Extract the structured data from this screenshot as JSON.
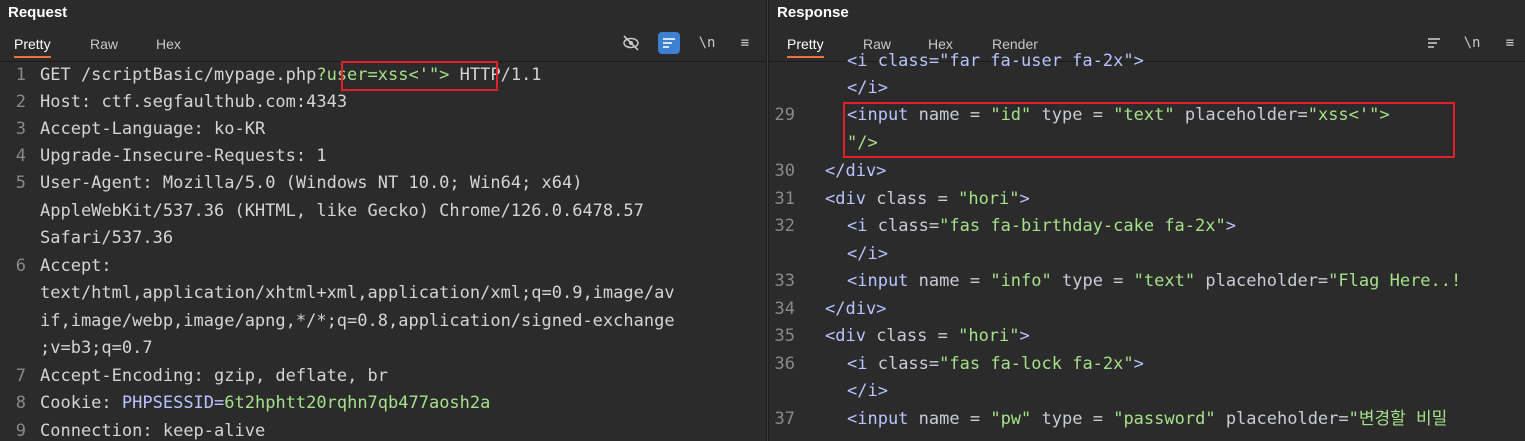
{
  "request": {
    "title": "Request",
    "tabs": [
      "Pretty",
      "Raw",
      "Hex"
    ],
    "active_tab": "Pretty",
    "tools": {
      "wrap_label": "\\n",
      "menu_label": "≡"
    },
    "lines": [
      {
        "num": "1",
        "method": "GET /scriptBasic/mypage.php",
        "query_key": "?user=",
        "query_val": "xss<'\">",
        "tail": " HTTP/1.1"
      },
      {
        "num": "2",
        "name": "Host",
        "value": "ctf.segfaulthub.com:4343"
      },
      {
        "num": "3",
        "name": "Accept-Language",
        "value": "ko-KR"
      },
      {
        "num": "4",
        "name": "Upgrade-Insecure-Requests",
        "value": "1"
      },
      {
        "num": "5",
        "name": "User-Agent",
        "value": "Mozilla/5.0 (Windows NT 10.0; Win64; x64)",
        "cont": [
          "AppleWebKit/537.36 (KHTML, like Gecko) Chrome/126.0.6478.57",
          "Safari/537.36"
        ]
      },
      {
        "num": "6",
        "name": "Accept",
        "value": "",
        "cont": [
          "text/html,application/xhtml+xml,application/xml;q=0.9,image/av",
          "if,image/webp,image/apng,*/*;q=0.8,application/signed-exchange",
          ";v=b3;q=0.7"
        ]
      },
      {
        "num": "7",
        "name": "Accept-Encoding",
        "value": "gzip, deflate, br"
      },
      {
        "num": "8",
        "name": "Cookie",
        "cookie_key": "PHPSESSID=",
        "cookie_val": "6t2hphtt20rqhn7qb477aosh2a"
      },
      {
        "num": "9",
        "name": "Connection",
        "value": "keep-alive"
      }
    ]
  },
  "response": {
    "title": "Response",
    "tabs": [
      "Pretty",
      "Raw",
      "Hex",
      "Render"
    ],
    "active_tab": "Pretty",
    "tools": {
      "wrap_label": "\\n",
      "menu_label": "≡"
    },
    "line28_partial": "<i class=\"far fa-user fa-2x\">",
    "close_i": "</i>",
    "input_id": {
      "num": "29",
      "name": "id",
      "type": "text",
      "placeholder": "xss<'\">",
      "cont": "\"/>"
    },
    "close_div_30": {
      "num": "30",
      "text": "</div>"
    },
    "div31": {
      "num": "31",
      "cls": "hori"
    },
    "i32": {
      "num": "32",
      "cls": "fas fa-birthday-cake fa-2x"
    },
    "input33": {
      "num": "33",
      "name": "info",
      "type": "text",
      "placeholder": "Flag Here..!"
    },
    "close_div_34": {
      "num": "34",
      "text": "</div>"
    },
    "div35": {
      "num": "35",
      "cls": "hori"
    },
    "i36": {
      "num": "36",
      "cls": "fas fa-lock fa-2x"
    },
    "input37": {
      "num": "37",
      "name": "pw",
      "type": "password",
      "placeholder": "변경할 비밀"
    }
  },
  "colors": {
    "highlight": "#e0212a",
    "active_tab_underline": "#e8743b",
    "string": "#a5e08a"
  }
}
